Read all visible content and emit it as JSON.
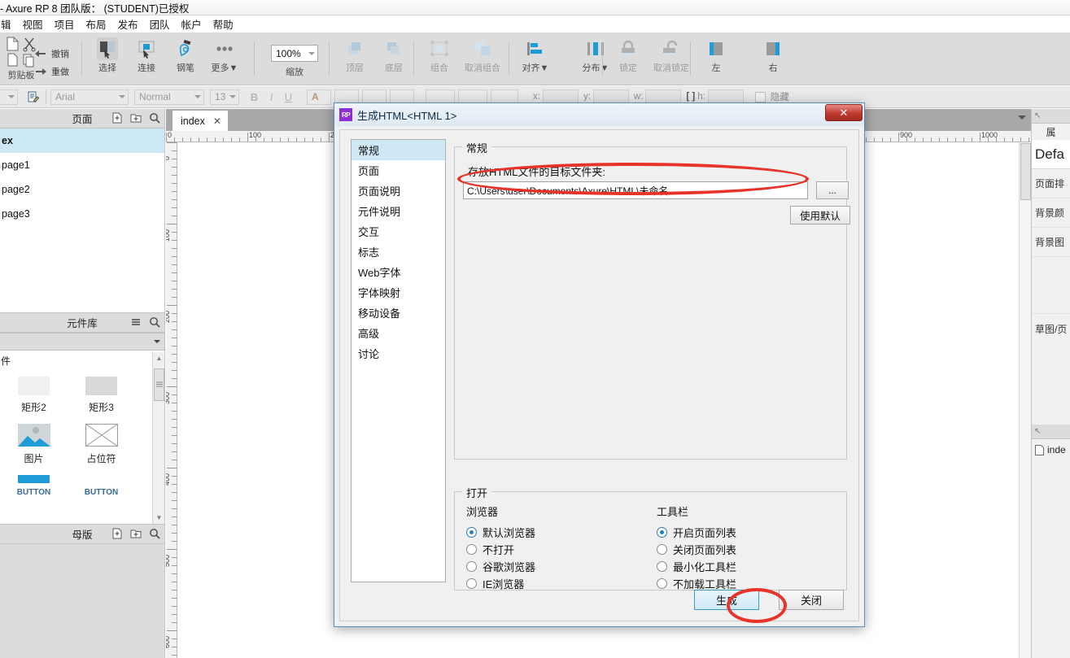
{
  "window": {
    "title": "- Axure RP 8 团队版：   (STUDENT)已授权"
  },
  "menu": {
    "items": [
      "辑",
      "视图",
      "项目",
      "布局",
      "发布",
      "团队",
      "帐户",
      "帮助"
    ]
  },
  "toolbar": {
    "clipboard_label": "剪贴板",
    "undo_label": "撤销",
    "redo_label": "重做",
    "items": [
      {
        "label": "选择",
        "icon": "select-icon"
      },
      {
        "label": "连接",
        "icon": "connect-icon"
      },
      {
        "label": "钢笔",
        "icon": "pen-icon"
      },
      {
        "label": "更多▼",
        "icon": "more-icon"
      }
    ],
    "zoom_value": "100%",
    "zoom_label": "缩放",
    "order_items": [
      {
        "label": "顶层",
        "icon": "bring-to-front-icon"
      },
      {
        "label": "底层",
        "icon": "send-to-back-icon"
      }
    ],
    "group_items": [
      {
        "label": "组合",
        "icon": "group-icon"
      },
      {
        "label": "取消组合",
        "icon": "ungroup-icon"
      }
    ],
    "align_items": [
      {
        "label": "对齐▼",
        "icon": "align-icon"
      },
      {
        "label": "分布▼",
        "icon": "distribute-icon"
      }
    ],
    "lock_items": [
      {
        "label": "锁定",
        "icon": "lock-icon"
      },
      {
        "label": "取消锁定",
        "icon": "unlock-icon"
      }
    ],
    "side_items": [
      {
        "label": "左",
        "icon": "align-left-icon"
      },
      {
        "label": "右",
        "icon": "align-right-icon"
      }
    ]
  },
  "formatbar": {
    "font_family": "Arial",
    "font_weight": "Normal",
    "font_size": "13",
    "bold": "B",
    "italic": "I",
    "underline": "U",
    "x_label": "x:",
    "y_label": "y:",
    "w_label": "w:",
    "h_label": "h:",
    "hidden_label": "隐藏"
  },
  "pages_panel": {
    "title": "页面",
    "items": [
      {
        "label": "ex",
        "active": true
      },
      {
        "label": "page1",
        "active": false
      },
      {
        "label": "page2",
        "active": false
      },
      {
        "label": "page3",
        "active": false
      }
    ]
  },
  "widget_panel": {
    "title": "元件库",
    "partial_label": "件",
    "widgets": [
      {
        "label": "矩形2",
        "icon": "rect-light-icon"
      },
      {
        "label": "矩形3",
        "icon": "rect-dark-icon"
      },
      {
        "label": "图片",
        "icon": "image-icon"
      },
      {
        "label": "占位符",
        "icon": "placeholder-icon"
      }
    ],
    "cut_labels": [
      "BUTTON",
      "BUTTON"
    ]
  },
  "masters_panel": {
    "title": "母版"
  },
  "canvas": {
    "tab_label": "index",
    "h_ruler_labels": [
      "0",
      "100",
      "900",
      "1000"
    ],
    "v_ruler_labels": [
      "0",
      "100",
      "200",
      "300",
      "400",
      "500",
      "600"
    ]
  },
  "right_panel": {
    "title": "属",
    "page_name": "Defa",
    "rows": [
      "页面排",
      "背景颜",
      "背景图"
    ],
    "sketch_row": "草图/页",
    "file_item": "inde"
  },
  "dialog": {
    "title": "生成HTML<HTML 1>",
    "badge": "RP",
    "close_glyph": "✕",
    "nav": [
      {
        "label": "常规",
        "active": true
      },
      {
        "label": "页面",
        "active": false
      },
      {
        "label": "页面说明",
        "active": false
      },
      {
        "label": "元件说明",
        "active": false
      },
      {
        "label": "交互",
        "active": false
      },
      {
        "label": "标志",
        "active": false
      },
      {
        "label": "Web字体",
        "active": false
      },
      {
        "label": "字体映射",
        "active": false
      },
      {
        "label": "移动设备",
        "active": false
      },
      {
        "label": "高级",
        "active": false
      },
      {
        "label": "讨论",
        "active": false
      }
    ],
    "general": {
      "caption": "常规",
      "field_label": "存放HTML文件的目标文件夹:",
      "path_value": "C:\\Users\\user\\Documents\\Axure\\HTML\\未命名",
      "browse_label": "...",
      "default_label": "使用默认"
    },
    "open": {
      "caption": "打开",
      "browser_title": "浏览器",
      "browser_options": [
        {
          "label": "默认浏览器",
          "selected": true
        },
        {
          "label": "不打开",
          "selected": false
        },
        {
          "label": "谷歌浏览器",
          "selected": false
        },
        {
          "label": "IE浏览器",
          "selected": false
        }
      ],
      "toolbar_title": "工具栏",
      "toolbar_options": [
        {
          "label": "开启页面列表",
          "selected": true
        },
        {
          "label": "关闭页面列表",
          "selected": false
        },
        {
          "label": "最小化工具栏",
          "selected": false
        },
        {
          "label": "不加载工具栏",
          "selected": false
        }
      ]
    },
    "generate_label": "生成",
    "close_label": "关闭"
  },
  "colors": {
    "accent_blue": "#1f7fc4",
    "annotation_red": "#e8332a",
    "selection_blue": "#cce8f4",
    "dialog_border": "#5a8db8",
    "rp_purple": "#8e2fd6"
  }
}
